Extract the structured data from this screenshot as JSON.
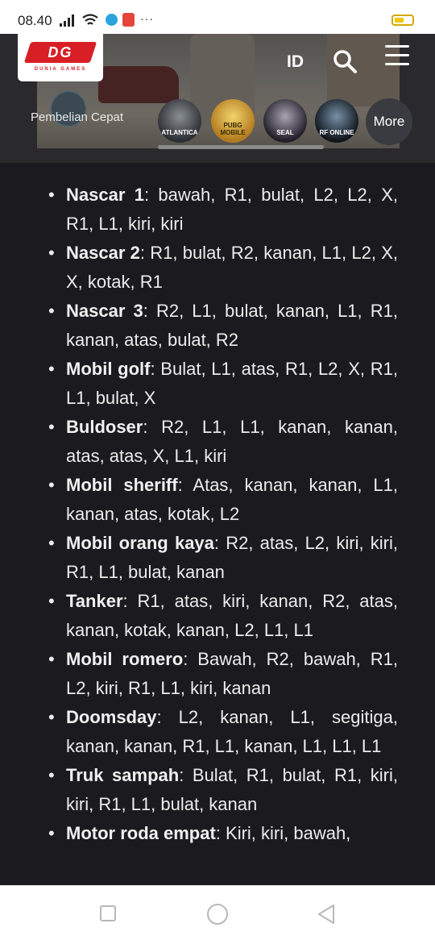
{
  "status_bar": {
    "time": "08.40",
    "icons": [
      "signal-icon",
      "wifi-icon",
      "telegram-icon",
      "store-icon",
      "more-dots-icon",
      "battery-icon"
    ],
    "dots": "···"
  },
  "header": {
    "logo_text": "DG",
    "logo_subtext": "DUNIA GAMES",
    "language": "ID",
    "quick_purchase_label": "Pembelian Cepat",
    "games": [
      {
        "label": "ATLANTICA"
      },
      {
        "label": "PUBG MOBILE"
      },
      {
        "label": "SEAL"
      },
      {
        "label": "RF ONLINE"
      }
    ],
    "more_label": "More"
  },
  "cheats": [
    {
      "name": "Nascar 1",
      "code": ": bawah, R1, bulat, L2, L2, X, R1, L1, kiri, kiri"
    },
    {
      "name": "Nascar 2",
      "code": ": R1, bulat, R2, kanan, L1, L2, X, X, kotak, R1"
    },
    {
      "name": "Nascar 3",
      "code": ": R2, L1, bulat, kanan, L1, R1, kanan, atas, bulat, R2"
    },
    {
      "name": "Mobil golf",
      "code": ": Bulat, L1, atas, R1, L2, X, R1, L1, bulat, X"
    },
    {
      "name": "Buldoser",
      "code": ": R2, L1, L1, kanan, kanan, atas, atas, X, L1, kiri"
    },
    {
      "name": "Mobil sheriff",
      "code": ": Atas, kanan, kanan, L1, kanan, atas, kotak, L2"
    },
    {
      "name": "Mobil orang kaya",
      "code": ": R2, atas, L2, kiri, kiri, R1, L1, bulat, kanan"
    },
    {
      "name": "Tanker",
      "code": ": R1, atas, kiri, kanan, R2, atas, kanan, kotak, kanan, L2, L1, L1"
    },
    {
      "name": "Mobil romero",
      "code": ": Bawah, R2, bawah, R1, L2, kiri, R1, L1, kiri, kanan"
    },
    {
      "name": "Doomsday",
      "code": ": L2, kanan, L1, segitiga, kanan, kanan, R1, L1, kanan, L1, L1, L1"
    },
    {
      "name": "Truk sampah",
      "code": ": Bulat, R1, bulat, R1, kiri, kiri, R1, L1, bulat, kanan"
    },
    {
      "name": "Motor roda empat",
      "code": ": Kiri, kiri, bawah,"
    }
  ],
  "nav_bar": {
    "icons": [
      "recent-apps-icon",
      "home-icon",
      "back-icon"
    ]
  }
}
